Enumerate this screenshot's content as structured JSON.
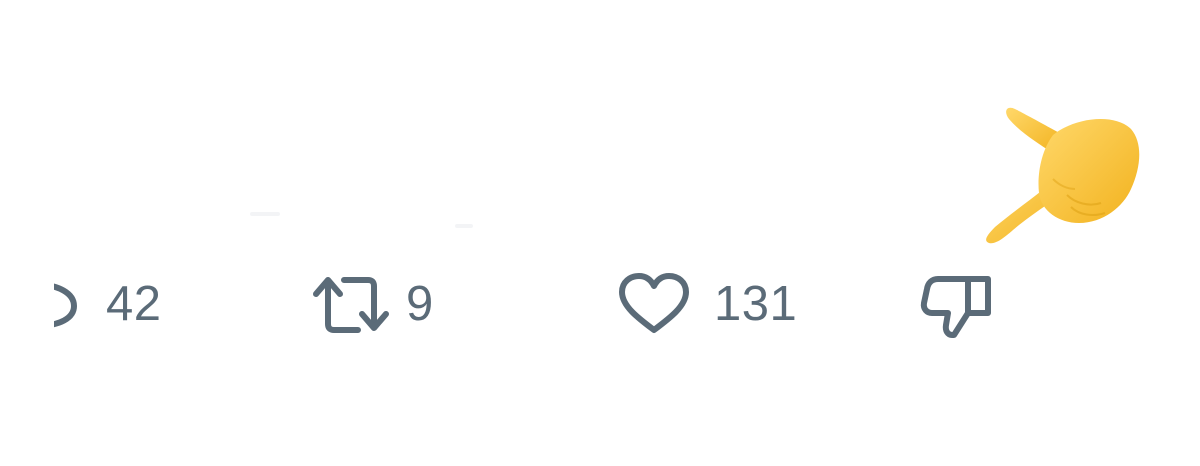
{
  "actions": {
    "reply": {
      "icon": "reply-icon",
      "count": "42"
    },
    "retweet": {
      "icon": "retweet-icon",
      "count": "9"
    },
    "like": {
      "icon": "heart-icon",
      "count": "131"
    },
    "dislike": {
      "icon": "thumbs-down-icon"
    }
  },
  "overlay": {
    "icon": "pointing-hand-emoji-icon"
  },
  "colors": {
    "icon": "#5b6b78",
    "background": "#ffffff",
    "hand": "#f7c531"
  }
}
